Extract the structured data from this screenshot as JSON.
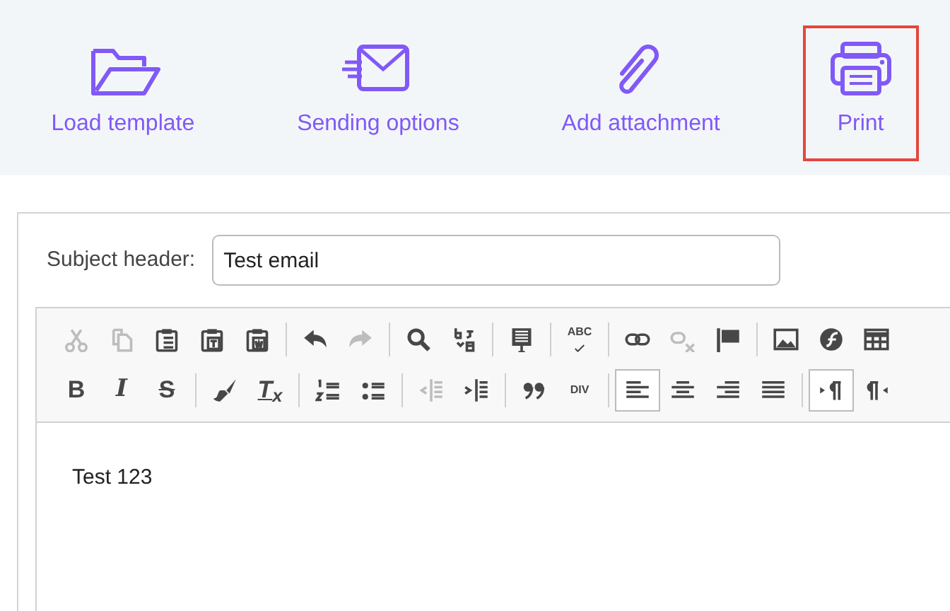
{
  "actions": [
    {
      "kind": "folder",
      "label": "Load template",
      "selected": false
    },
    {
      "kind": "envelope",
      "label": "Sending options",
      "selected": false
    },
    {
      "kind": "paperclip",
      "label": "Add attachment",
      "selected": false
    },
    {
      "kind": "printer",
      "label": "Print",
      "selected": true
    }
  ],
  "subject": {
    "label": "Subject header:",
    "value": "Test email"
  },
  "toolbar": {
    "rows": [
      {
        "groups": [
          {
            "tools": [
              {
                "kind": "cut",
                "disabled": true
              },
              {
                "kind": "copy",
                "disabled": true
              },
              {
                "kind": "paste",
                "disabled": false
              },
              {
                "kind": "paste-text",
                "disabled": false
              },
              {
                "kind": "paste-word",
                "disabled": false
              }
            ]
          },
          {
            "tools": [
              {
                "kind": "undo",
                "disabled": false
              },
              {
                "kind": "redo",
                "disabled": true
              }
            ]
          },
          {
            "tools": [
              {
                "kind": "find",
                "disabled": false
              },
              {
                "kind": "replace",
                "disabled": false
              }
            ]
          },
          {
            "tools": [
              {
                "kind": "templates",
                "disabled": false
              }
            ]
          },
          {
            "tools": [
              {
                "kind": "spellcheck",
                "glyph": "ABC",
                "disabled": false
              }
            ]
          },
          {
            "tools": [
              {
                "kind": "link",
                "disabled": false
              },
              {
                "kind": "unlink",
                "disabled": true
              },
              {
                "kind": "anchor",
                "disabled": false
              }
            ]
          },
          {
            "tools": [
              {
                "kind": "image",
                "disabled": false
              },
              {
                "kind": "flash",
                "disabled": false
              },
              {
                "kind": "table",
                "disabled": false
              }
            ]
          }
        ]
      },
      {
        "groups": [
          {
            "tools": [
              {
                "kind": "bold",
                "glyph": "B",
                "disabled": false
              },
              {
                "kind": "italic",
                "glyph": "I",
                "disabled": false
              },
              {
                "kind": "strike",
                "glyph": "S",
                "disabled": false
              }
            ]
          },
          {
            "tools": [
              {
                "kind": "brush",
                "disabled": false
              },
              {
                "kind": "remove-format",
                "glyph": "T$_{x}$",
                "disabled": false
              }
            ]
          },
          {
            "tools": [
              {
                "kind": "numbered-list",
                "disabled": false
              },
              {
                "kind": "bulleted-list",
                "disabled": false
              }
            ]
          },
          {
            "tools": [
              {
                "kind": "outdent",
                "disabled": true
              },
              {
                "kind": "indent",
                "disabled": false
              }
            ]
          },
          {
            "tools": [
              {
                "kind": "blockquote",
                "disabled": false
              },
              {
                "kind": "div",
                "glyph": "DIV",
                "disabled": false
              }
            ]
          },
          {
            "tools": [
              {
                "kind": "align-left",
                "disabled": false,
                "selected": true
              },
              {
                "kind": "align-center",
                "disabled": false,
                "selected": false
              },
              {
                "kind": "align-right",
                "disabled": false,
                "selected": false
              },
              {
                "kind": "align-justify",
                "disabled": false,
                "selected": false
              }
            ]
          },
          {
            "tools": [
              {
                "kind": "ltr",
                "disabled": false,
                "selected": true
              },
              {
                "kind": "rtl",
                "disabled": false,
                "selected": false
              }
            ]
          }
        ]
      }
    ]
  },
  "body": {
    "text": "Test 123"
  }
}
